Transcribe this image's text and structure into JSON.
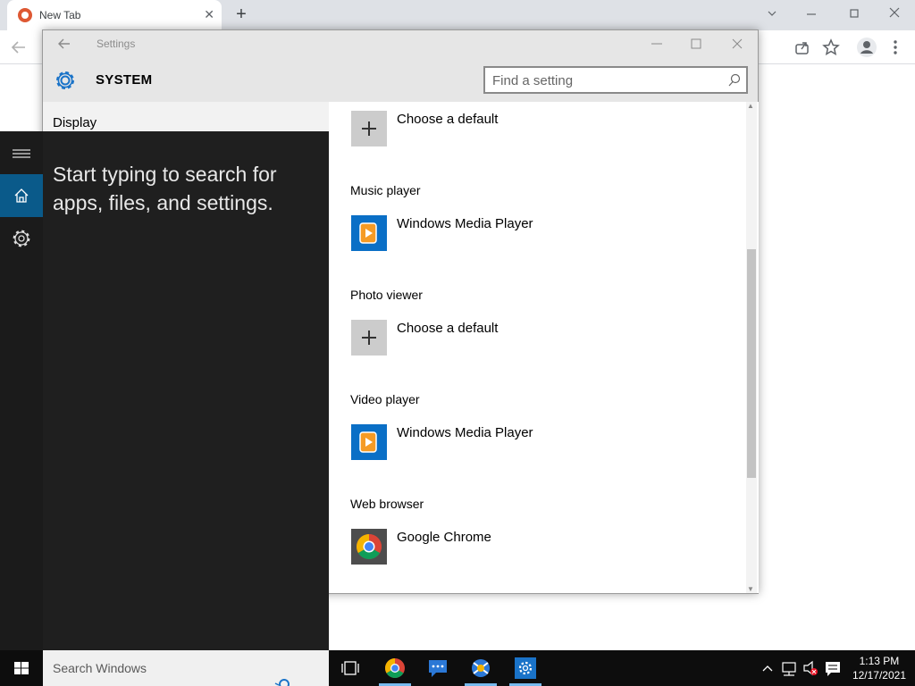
{
  "browser": {
    "tab_title": "New Tab",
    "tab_close": "✕",
    "new_tab": "+"
  },
  "settings": {
    "window_title": "Settings",
    "header_title": "SYSTEM",
    "search_placeholder": "Find a setting",
    "left_nav_item": "Display",
    "sections": [
      {
        "label": "",
        "app": "Choose a default",
        "icon": "plus-icon"
      },
      {
        "label": "Music player",
        "app": "Windows Media Player",
        "icon": "windows-media-player-icon"
      },
      {
        "label": "Photo viewer",
        "app": "Choose a default",
        "icon": "plus-icon"
      },
      {
        "label": "Video player",
        "app": "Windows Media Player",
        "icon": "windows-media-player-icon"
      },
      {
        "label": "Web browser",
        "app": "Google Chrome",
        "icon": "chrome-icon"
      }
    ]
  },
  "start": {
    "hint": "Start typing to search for apps, files, and settings.",
    "rail": [
      "hamburger-icon",
      "home-icon",
      "gear-icon"
    ]
  },
  "taskbar": {
    "search_placeholder": "Search Windows",
    "time": "1:13 PM",
    "date": "12/17/2021",
    "pinned": [
      "task-view-icon",
      "chrome-icon",
      "chat-icon",
      "network-app-icon",
      "settings-icon"
    ]
  },
  "colors": {
    "accent": "#0a5a8a",
    "settings_accent": "#1a73c8",
    "taskbar": "#0d0d0d"
  }
}
